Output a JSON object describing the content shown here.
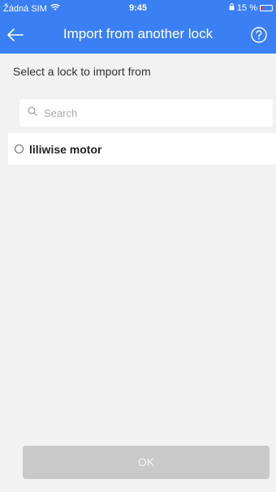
{
  "status_bar": {
    "carrier": "Žádná SIM",
    "time": "9:45",
    "battery": "15 %",
    "battery_level": 0.15,
    "wifi_icon": "wifi-icon"
  },
  "header": {
    "title": "Import from another lock",
    "back_icon": "arrow-left-icon",
    "help_icon": "question-circle-icon",
    "background_color": "#3b7ff5"
  },
  "main": {
    "subtitle": "Select a lock to import from",
    "search": {
      "placeholder": "Search",
      "value": ""
    },
    "locks": [
      {
        "label": "liliwise motor",
        "selected": false
      }
    ]
  },
  "footer": {
    "ok_label": "OK",
    "ok_enabled": false
  }
}
